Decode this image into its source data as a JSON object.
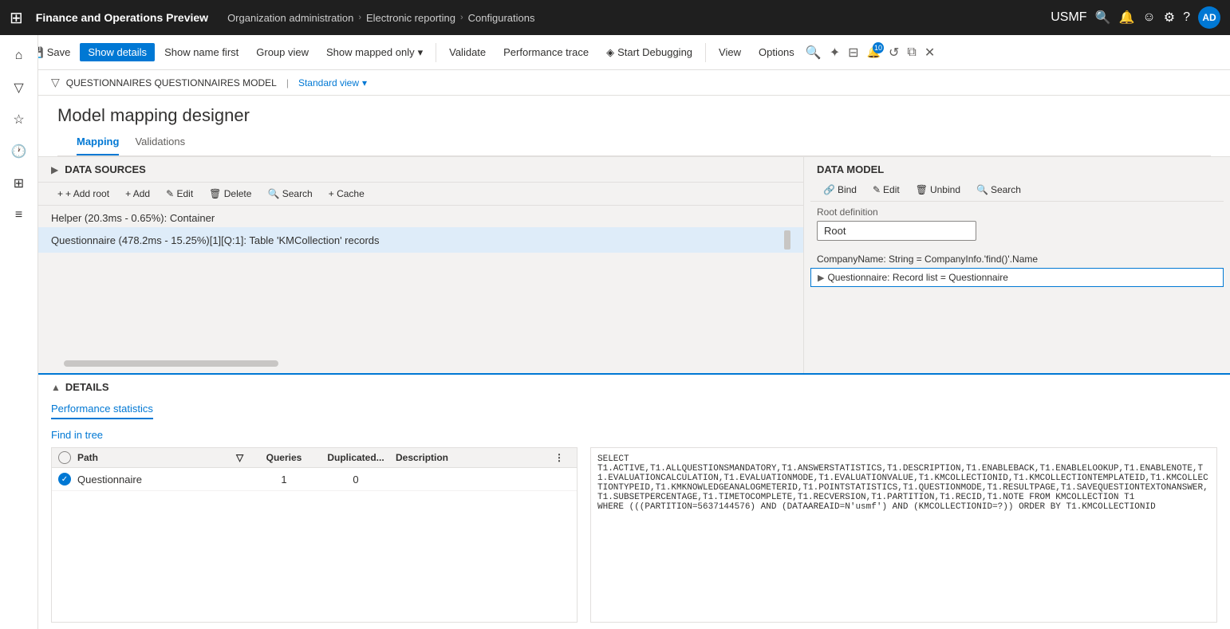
{
  "topnav": {
    "app_title": "Finance and Operations Preview",
    "breadcrumbs": [
      {
        "label": "Organization administration"
      },
      {
        "label": "Electronic reporting"
      },
      {
        "label": "Configurations"
      }
    ],
    "usmf": "USMF",
    "avatar_initials": "AD"
  },
  "toolbar": {
    "save_label": "Save",
    "show_details_label": "Show details",
    "show_name_first_label": "Show name first",
    "group_view_label": "Group view",
    "show_mapped_label": "Show mapped only",
    "validate_label": "Validate",
    "performance_trace_label": "Performance trace",
    "start_debugging_label": "Start Debugging",
    "view_label": "View",
    "options_label": "Options"
  },
  "breadcrumb_bar": {
    "path": "QUESTIONNAIRES QUESTIONNAIRES MODEL",
    "separator": "|",
    "view_label": "Standard view"
  },
  "page": {
    "title": "Model mapping designer"
  },
  "tabs": [
    {
      "label": "Mapping",
      "active": true
    },
    {
      "label": "Validations",
      "active": false
    }
  ],
  "left_panel": {
    "title": "DATA SOURCES",
    "buttons": [
      {
        "label": "+ Add root",
        "disabled": false
      },
      {
        "label": "+ Add",
        "disabled": false
      },
      {
        "label": "✎ Edit",
        "disabled": false
      },
      {
        "label": "🗑 Delete",
        "disabled": false
      },
      {
        "label": "🔍 Search",
        "disabled": false
      },
      {
        "label": "+ Cache",
        "disabled": false
      }
    ],
    "items": [
      {
        "label": "Helper (20.3ms - 0.65%): Container",
        "selected": false
      },
      {
        "label": "Questionnaire (478.2ms - 15.25%)[1][Q:1]: Table 'KMCollection' records",
        "selected": true
      }
    ]
  },
  "right_panel": {
    "title": "DATA MODEL",
    "buttons": [
      {
        "label": "Bind",
        "icon": "🔗"
      },
      {
        "label": "Edit",
        "icon": "✎"
      },
      {
        "label": "Unbind",
        "icon": "🗑"
      },
      {
        "label": "Search",
        "icon": "🔍"
      }
    ],
    "root_definition_label": "Root definition",
    "root_value": "Root",
    "items": [
      {
        "label": "CompanyName: String = CompanyInfo.'find()'.Name",
        "selected": false,
        "has_expand": false
      },
      {
        "label": "Questionnaire: Record list = Questionnaire",
        "selected": true,
        "has_expand": true
      }
    ]
  },
  "details": {
    "title": "DETAILS",
    "tab_label": "Performance statistics",
    "find_in_tree": "Find in tree",
    "table": {
      "columns": [
        "Path",
        "Queries",
        "Duplicated...",
        "Description"
      ],
      "rows": [
        {
          "path": "Questionnaire",
          "queries": "1",
          "duplicated": "0",
          "description": ""
        }
      ]
    },
    "sql_text": "SELECT\nT1.ACTIVE,T1.ALLQUESTIONSMANDATORY,T1.ANSWERSTATISTICS,T1.DESCRIPTION,T1.ENABLEBACK,T1.ENABLELOOKUP,T1.ENABLENOTE,T1.EVALUATIONCALCULATION,T1.EVALUATIONMODE,T1.EVALUATIONVALUE,T1.KMCOLLECTIONID,T1.KMCOLLECTIONTEMPLATEID,T1.KMCOLLECTIONTYPEID,T1.KMKNOWLEDGEANALOGMETERID,T1.POINTSTATISTICS,T1.QUESTIONMODE,T1.RESULTPAGE,T1.SAVEQUESTIONTEXTONANSWER,T1.SUBSETPERCENTAGE,T1.TIMETOCOMPLETE,T1.RECVERSION,T1.PARTITION,T1.RECID,T1.NOTE FROM KMCOLLECTION T1\nWHERE (((PARTITION=5637144576) AND (DATAAREAID=N'usmf') AND (KMCOLLECTIONID=?)) ORDER BY T1.KMCOLLECTIONID"
  }
}
